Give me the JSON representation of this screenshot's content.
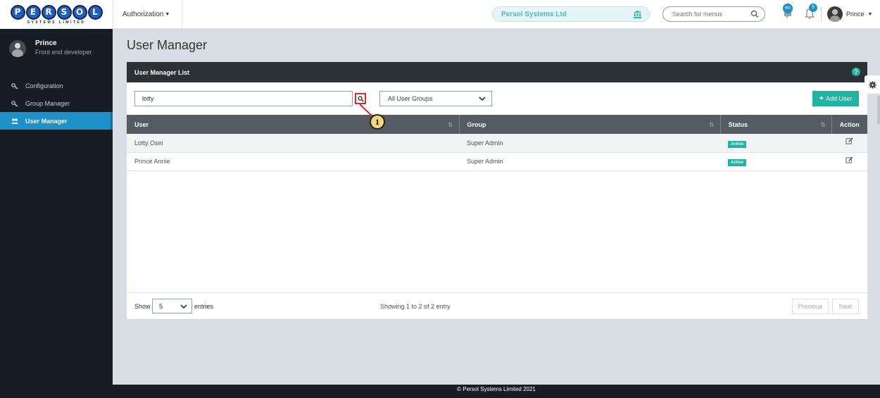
{
  "logo": {
    "letters": [
      "P",
      "E",
      "R",
      "S",
      "O",
      "L"
    ],
    "tagline": "SYSTEMS LIMITED"
  },
  "header": {
    "module": "Authorization",
    "company": "Persol Systems Ltd",
    "menu_search_placeholder": "Search for menus",
    "language_badge": "en",
    "notification_count": "5",
    "user_name": "Prince"
  },
  "sidebar": {
    "profile_name": "Prince",
    "profile_role": "Front end developer",
    "items": [
      {
        "label": "Configuration",
        "icon": "key-icon",
        "active": false
      },
      {
        "label": "Group Manager",
        "icon": "key-icon",
        "active": false
      },
      {
        "label": "User Manager",
        "icon": "users-icon",
        "active": true
      }
    ]
  },
  "page": {
    "title": "User Manager",
    "panel_title": "User Manager List",
    "search_value": "lotty",
    "callout_number": "1",
    "group_filter": "All User Groups",
    "add_button": "Add User"
  },
  "table": {
    "columns": [
      "User",
      "Group",
      "Status",
      "Action"
    ],
    "rows": [
      {
        "user": "Lotty Osei",
        "group": "Super Admin",
        "status": "Active"
      },
      {
        "user": "Prince Annie",
        "group": "Super Admin",
        "status": "Active"
      }
    ]
  },
  "pagination": {
    "show_label": "Show",
    "page_size": "5",
    "entries_label": "entries",
    "info": "Showing 1 to 2 of 2 entry",
    "previous": "Previous",
    "next": "Next"
  },
  "footer": {
    "copyright": "© Persol Systems Limited 2021"
  },
  "colors": {
    "accent": "#1e90c9",
    "teal": "#1fb5a3",
    "sidebar": "#161d26",
    "header_dark": "#2c3136",
    "table_head": "#545b62",
    "highlight": "#e0282f"
  }
}
